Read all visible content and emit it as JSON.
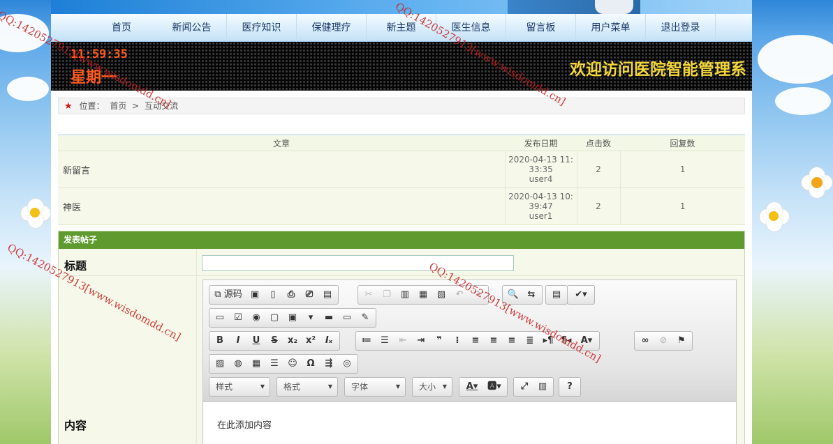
{
  "nav": {
    "items": [
      "首页",
      "新闻公告",
      "医疗知识",
      "保健理疗",
      "新主题",
      "医生信息",
      "留言板",
      "用户菜单",
      "退出登录"
    ]
  },
  "banner": {
    "time": "11:59:35",
    "weekday": "星期一",
    "welcome": "欢迎访问医院智能管理系"
  },
  "breadcrumb": {
    "label": "位置：",
    "home": "首页",
    "sep": ">",
    "current": "互动交流"
  },
  "table": {
    "headers": [
      "文章",
      "发布日期",
      "点击数",
      "回复数"
    ],
    "rows": [
      {
        "title": "新留言",
        "date1": "2020-04-13 11:",
        "date2": "33:35",
        "user": "user4",
        "clicks": "2",
        "replies": "1"
      },
      {
        "title": "神医",
        "date1": "2020-04-13 10:",
        "date2": "39:47",
        "user": "user1",
        "clicks": "2",
        "replies": "1"
      }
    ]
  },
  "form": {
    "heading": "发表帖子",
    "title_label": "标题",
    "content_label": "内容",
    "title_value": "",
    "editor_placeholder": "在此添加内容"
  },
  "editor": {
    "source_label": "源码",
    "combos": [
      "样式",
      "格式",
      "字体",
      "大小"
    ]
  },
  "watermark": "QQ:1420527913[www.wisdomdd.cn]",
  "colors": {
    "nav_text": "#1b3a66",
    "clock": "#ff5a1f",
    "welcome": "#f2d63a",
    "form_header": "#5f9a2e",
    "watermark": "#c8201e"
  }
}
